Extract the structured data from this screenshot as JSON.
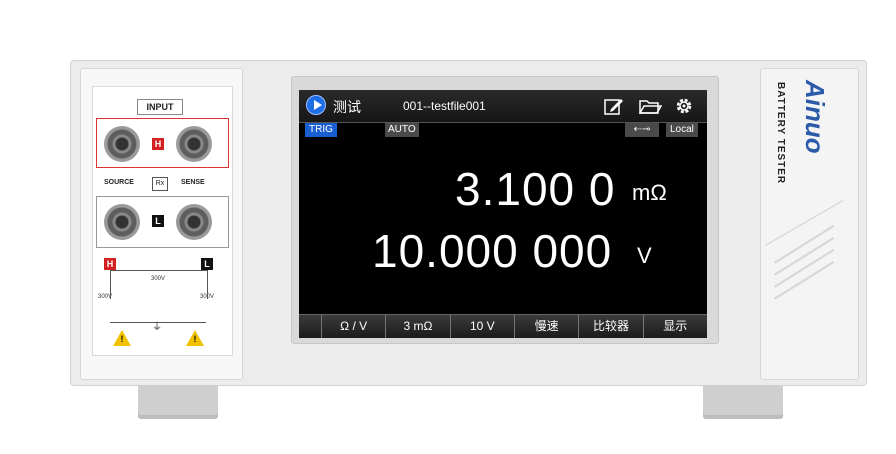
{
  "panel": {
    "input_label": "INPUT",
    "h": "H",
    "l": "L",
    "source": "SOURCE",
    "sense": "SENSE",
    "rx": "Rx",
    "v300": "300V",
    "v300_left": "300V",
    "v300_right": "300V",
    "warn_mark": "!",
    "gnd": "⏚"
  },
  "screen": {
    "title": "测试",
    "file": "001--testfile001",
    "trig": "TRIG",
    "auto": "AUTO",
    "usb": "⇠⊸",
    "local": "Local",
    "reading_resistance": "3.100 0",
    "unit_resistance": "mΩ",
    "reading_voltage": "10.000 000",
    "unit_voltage": "V",
    "softkeys": [
      "Ω / V",
      "3 mΩ",
      "10 V",
      "慢速",
      "比较器",
      "显示"
    ]
  },
  "brand": {
    "name": "Ainuo",
    "model": "BATTERY TESTER"
  },
  "colors": {
    "brand": "#2a5aa8",
    "accent": "#1a5fd1",
    "danger": "#d32020"
  }
}
